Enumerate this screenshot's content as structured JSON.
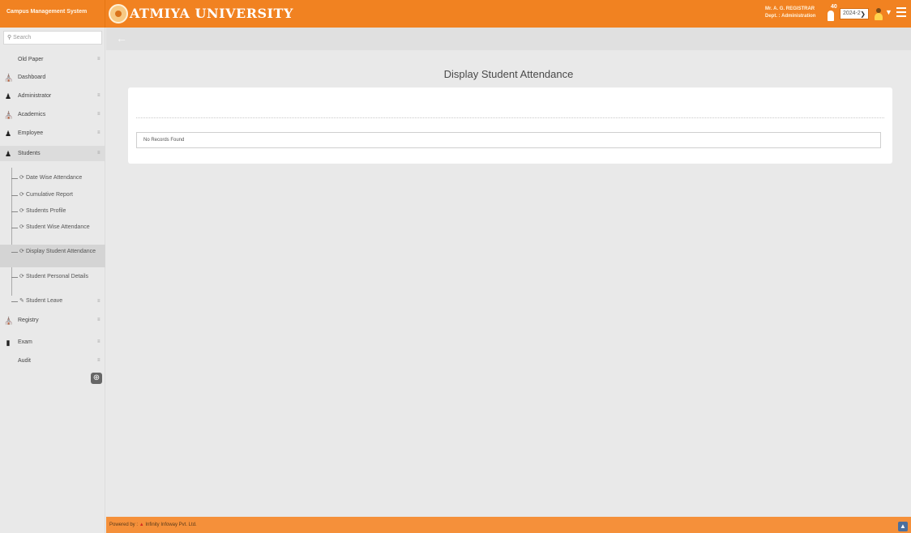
{
  "header": {
    "system_name": "Campus Management System",
    "university_name": "ATMIYA UNIVERSITY",
    "user_name": "Mr. A. G. REGISTRAR",
    "user_dept": "Dept. : Administration",
    "notification_count": "40",
    "year_selected": "2024-2"
  },
  "sidebar": {
    "search_placeholder": "Search",
    "items": [
      {
        "label": "Old Paper",
        "icon": "none",
        "has_arrow": true
      },
      {
        "label": "Dashboard",
        "icon": "bank-icon",
        "has_arrow": false
      },
      {
        "label": "Administrator",
        "icon": "user-icon",
        "has_arrow": true
      },
      {
        "label": "Academics",
        "icon": "bank-icon",
        "has_arrow": true
      },
      {
        "label": "Employee",
        "icon": "users-icon",
        "has_arrow": true
      },
      {
        "label": "Students",
        "icon": "user-icon",
        "has_arrow": true
      }
    ],
    "sub_items": [
      {
        "label": "Date Wise Attendance"
      },
      {
        "label": "Cumulative Report"
      },
      {
        "label": "Students Profile"
      },
      {
        "label": "Student Wise Attendance"
      },
      {
        "label": "Display Student Attendance"
      },
      {
        "label": "Student Personal Details"
      },
      {
        "label": "Student Leave"
      }
    ],
    "bottom_items": [
      {
        "label": "Registry",
        "icon": "bank-icon"
      },
      {
        "label": "Exam",
        "icon": "book-icon"
      },
      {
        "label": "Audit",
        "icon": "none"
      }
    ]
  },
  "main": {
    "page_title": "Display Student Attendance",
    "no_records": "No Records Found"
  },
  "footer": {
    "powered_by": "Powered by :",
    "company": "Infinity Infoway Pvt. Ltd."
  },
  "colors": {
    "brand_orange": "#f18221",
    "footer_orange": "#f5903a",
    "sidebar_bg": "#e9e9e9"
  }
}
